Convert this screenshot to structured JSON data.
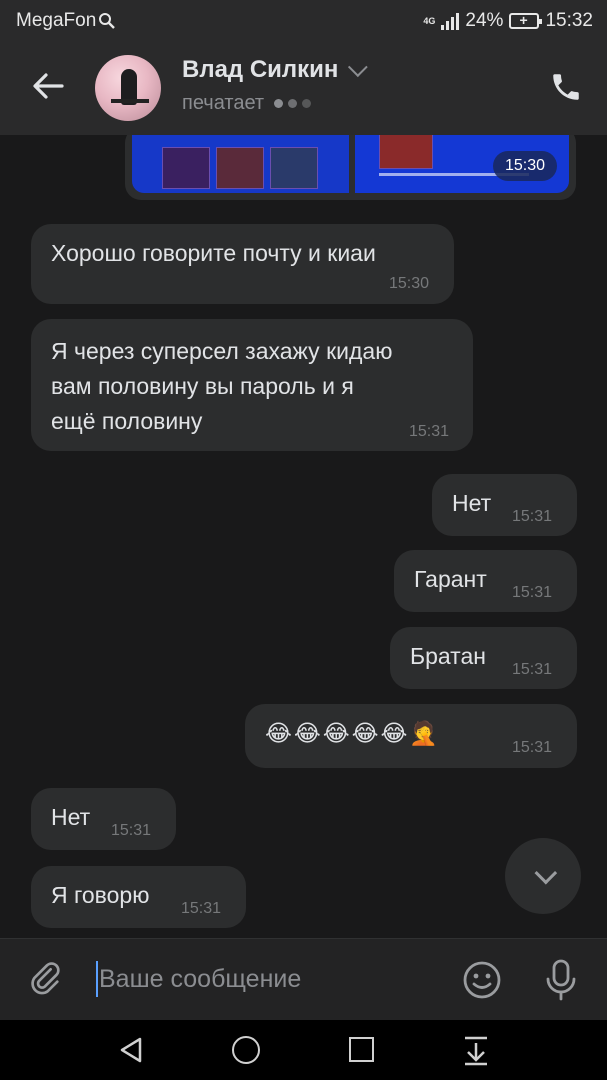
{
  "status_bar": {
    "carrier": "MegaFon",
    "network": "4G",
    "battery": "24%",
    "time": "15:32"
  },
  "header": {
    "name": "Влад Силкин",
    "status": "печатает"
  },
  "photo_message": {
    "time": "15:30"
  },
  "messages": [
    {
      "side": "in",
      "text": "Хорошо говорите почту и киаи",
      "time": "15:30"
    },
    {
      "side": "in",
      "text": "Я через суперсел захажу кидаю вам половину вы пароль и я ещё половину",
      "lines": [
        "Я через суперсел захажу кидаю",
        "вам половину вы пароль и я",
        "ещё половину"
      ],
      "time": "15:31"
    },
    {
      "side": "out",
      "text": "Нет",
      "time": "15:31"
    },
    {
      "side": "out",
      "text": "Гарант",
      "time": "15:31"
    },
    {
      "side": "out",
      "text": "Братан",
      "time": "15:31"
    },
    {
      "side": "out",
      "text": "😂😂😂😂😂🤦",
      "time": "15:31"
    },
    {
      "side": "in",
      "text": "Нет",
      "time": "15:31"
    },
    {
      "side": "in",
      "text": "Я говорю",
      "time": "15:31"
    }
  ],
  "composer": {
    "placeholder": "Ваше сообщение"
  },
  "colors": {
    "background": "#19191a",
    "bubble": "#2c2d2e",
    "header": "#2a2a2b",
    "caret": "#5aa0ff"
  },
  "icons": [
    "search-icon",
    "signal-icon",
    "battery-icon",
    "back-arrow-icon",
    "chevron-down-icon",
    "typing-dots-icon",
    "phone-icon",
    "scroll-down-icon",
    "paperclip-icon",
    "smile-icon",
    "microphone-icon",
    "nav-back-icon",
    "nav-home-icon",
    "nav-recents-icon",
    "nav-notifications-icon"
  ]
}
